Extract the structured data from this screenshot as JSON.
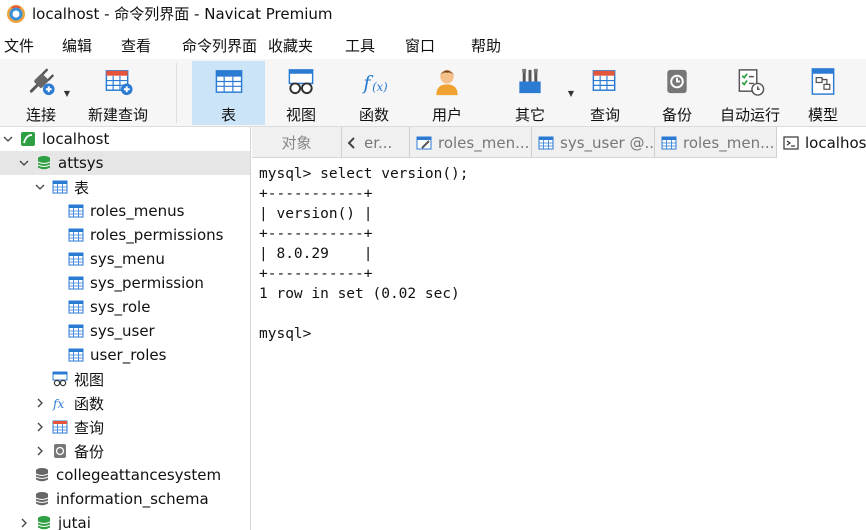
{
  "window": {
    "title": "localhost - 命令列界面 - Navicat Premium"
  },
  "menu": {
    "items": [
      "文件",
      "编辑",
      "查看",
      "命令列界面",
      "收藏夹",
      "工具",
      "窗口",
      "帮助"
    ]
  },
  "toolbar": {
    "buttons": [
      {
        "label": "连接",
        "icon": "connect-plug-icon",
        "has_dropdown": true
      },
      {
        "label": "新建查询",
        "icon": "new-query-icon"
      },
      {
        "label": "表",
        "icon": "table-icon",
        "active": true
      },
      {
        "label": "视图",
        "icon": "view-glasses-icon"
      },
      {
        "label": "函数",
        "icon": "function-fx-icon"
      },
      {
        "label": "用户",
        "icon": "user-icon"
      },
      {
        "label": "其它",
        "icon": "tools-icon",
        "has_dropdown": true
      },
      {
        "label": "查询",
        "icon": "query-icon"
      },
      {
        "label": "备份",
        "icon": "backup-icon"
      },
      {
        "label": "自动运行",
        "icon": "automation-icon"
      },
      {
        "label": "模型",
        "icon": "model-icon"
      }
    ]
  },
  "sidebar": {
    "connection": "localhost",
    "database": "attsys",
    "tables_group": "表",
    "tables": [
      "roles_menus",
      "roles_permissions",
      "sys_menu",
      "sys_permission",
      "sys_role",
      "sys_user",
      "user_roles"
    ],
    "views_group": "视图",
    "functions_group": "函数",
    "queries_group": "查询",
    "backups_group": "备份",
    "other_databases": [
      "collegeattancesystem",
      "information_schema",
      "jutai"
    ]
  },
  "tabs": {
    "objects": "对象",
    "items": [
      {
        "label": "er..."
      },
      {
        "label": "roles_men..."
      },
      {
        "label": "sys_user @..."
      },
      {
        "label": "roles_men..."
      },
      {
        "label": "localhost",
        "active": true
      }
    ]
  },
  "console": {
    "lines": [
      "mysql> select version();",
      "+-----------+",
      "| version() |",
      "+-----------+",
      "| 8.0.29    |",
      "+-----------+",
      "1 row in set (0.02 sec)",
      "",
      "mysql>"
    ]
  },
  "colors": {
    "accent_active": "#cce4f7",
    "db_green": "#2ea043",
    "table_blue": "#2b7bd3"
  }
}
